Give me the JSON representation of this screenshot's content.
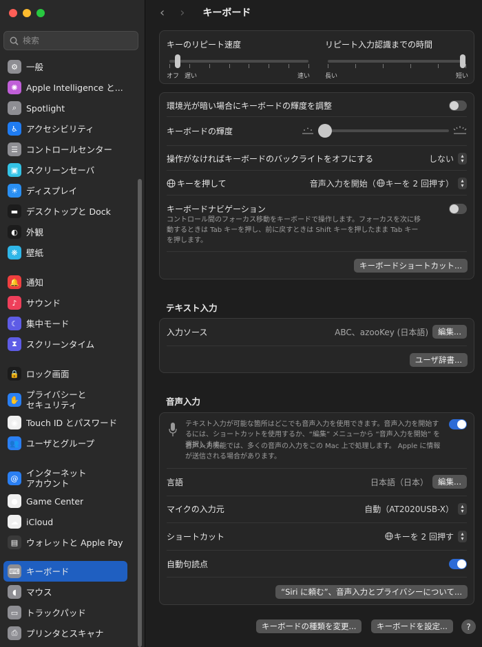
{
  "window": {
    "title": "キーボード"
  },
  "search": {
    "placeholder": "検索"
  },
  "sidebar": {
    "items": [
      {
        "label": "一般",
        "icon": "gear-icon",
        "color": "#8e8e93"
      },
      {
        "label": "Apple Intelligence と...",
        "icon": "apple-intelligence-icon",
        "color": "#c05fd8"
      },
      {
        "label": "Spotlight",
        "icon": "spotlight-icon",
        "color": "#8e8e93"
      },
      {
        "label": "アクセシビリティ",
        "icon": "accessibility-icon",
        "color": "#1f7cf2"
      },
      {
        "label": "コントロールセンター",
        "icon": "control-center-icon",
        "color": "#8e8e93"
      },
      {
        "label": "スクリーンセーバ",
        "icon": "screensaver-icon",
        "color": "#34c3e6"
      },
      {
        "label": "ディスプレイ",
        "icon": "display-icon",
        "color": "#2a8ff2"
      },
      {
        "label": "デスクトップと Dock",
        "icon": "dock-icon",
        "color": "#1c1c1c"
      },
      {
        "label": "外観",
        "icon": "appearance-icon",
        "color": "#1c1c1c"
      },
      {
        "label": "壁紙",
        "icon": "wallpaper-icon",
        "color": "#2fb6e8"
      },
      {
        "label": "通知",
        "icon": "notification-icon",
        "color": "#ee3f3f"
      },
      {
        "label": "サウンド",
        "icon": "sound-icon",
        "color": "#ee3f5a"
      },
      {
        "label": "集中モード",
        "icon": "focus-moon-icon",
        "color": "#5e5ce6"
      },
      {
        "label": "スクリーンタイム",
        "icon": "hourglass-icon",
        "color": "#5e5ce6"
      },
      {
        "label": "ロック画面",
        "icon": "lock-icon",
        "color": "#1c1c1c"
      },
      {
        "label": "プライバシーと\nセキュリティ",
        "icon": "privacy-hand-icon",
        "color": "#2a7ff2"
      },
      {
        "label": "Touch ID とパスワード",
        "icon": "fingerprint-icon",
        "color": "#f0f0f0"
      },
      {
        "label": "ユーザとグループ",
        "icon": "users-icon",
        "color": "#2a7ff2"
      },
      {
        "label": "インターネット\nアカウント",
        "icon": "at-icon",
        "color": "#2a7ff2"
      },
      {
        "label": "Game Center",
        "icon": "game-center-icon",
        "color": "#f0f0f0"
      },
      {
        "label": "iCloud",
        "icon": "icloud-icon",
        "color": "#f0f0f0"
      },
      {
        "label": "ウォレットと Apple Pay",
        "icon": "wallet-icon",
        "color": "#3a3a3a"
      },
      {
        "label": "キーボード",
        "icon": "keyboard-icon",
        "color": "#8e8e93"
      },
      {
        "label": "マウス",
        "icon": "mouse-icon",
        "color": "#8e8e93"
      },
      {
        "label": "トラックパッド",
        "icon": "trackpad-icon",
        "color": "#8e8e93"
      },
      {
        "label": "プリンタとスキャナ",
        "icon": "printer-icon",
        "color": "#8e8e93"
      }
    ]
  },
  "repeat": {
    "rate_label": "キーのリピート速度",
    "delay_label": "リピート入力認識までの時間",
    "rate_off": "オフ",
    "rate_slow": "遅い",
    "rate_fast": "速い",
    "delay_long": "長い",
    "delay_short": "短い",
    "rate_value": 0.04,
    "delay_value": 1.0
  },
  "backlight": {
    "auto_label": "環境光が暗い場合にキーボードの輝度を調整",
    "auto_on": false,
    "brightness_label": "キーボードの輝度",
    "brightness_value": 0.0,
    "off_label": "操作がなければキーボードのバックライトをオフにする",
    "off_value": "しない",
    "globe_label": "キーを押して",
    "globe_value": "音声入力を開始（",
    "globe_value_tail": "キーを 2 回押す）",
    "nav_label": "キーボードナビゲーション",
    "nav_desc": "コントロール間のフォーカス移動をキーボードで操作します。フォーカスを次に移動するときは Tab キーを押し、前に戻すときは Shift キーを押したまま Tab キーを押します。",
    "nav_on": false,
    "shortcut_button": "キーボードショートカット..."
  },
  "text_input": {
    "section": "テキスト入力",
    "sources_label": "入力ソース",
    "sources_value": "ABC、azooKey (日本語)",
    "edit_button": "編集...",
    "dict_button": "ユーザ辞書..."
  },
  "dictation": {
    "section": "音声入力",
    "desc1": "テキスト入力が可能な箇所はどこでも音声入力を使用できます。音声入力を開始するには、ショートカットを使用するか、“編集” メニューから “音声入力を開始” を選択します。",
    "desc2": "音声入力機能では、多くの音声の入力をこの Mac 上で処理します。 Apple に情報が送信される場合があります。",
    "on": true,
    "lang_label": "言語",
    "lang_value": "日本語（日本）",
    "lang_edit": "編集...",
    "mic_label": "マイクの入力元",
    "mic_value": "自動（AT2020USB-X）",
    "shortcut_label": "ショートカット",
    "shortcut_value": "キーを 2 回押す",
    "punct_label": "自動句読点",
    "punct_on": true,
    "privacy_button": "“Siri に頼む”、音声入力とプライバシーについて..."
  },
  "footer": {
    "change_type": "キーボードの種類を変更...",
    "setup": "キーボードを設定...",
    "help": "?"
  },
  "colors": {
    "accent": "#1f5fc1",
    "toggle_on": "#2d6bd6",
    "light_red": "#ff5f57",
    "light_yellow": "#febc2e",
    "light_green": "#28c840"
  }
}
